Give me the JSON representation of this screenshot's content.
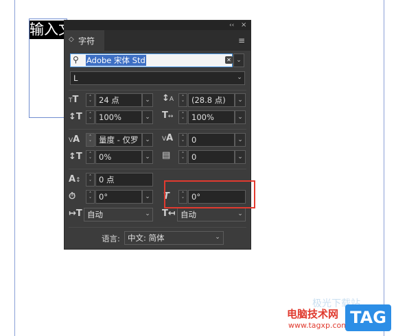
{
  "document": {
    "selected_text": "输入文"
  },
  "panel": {
    "collapse_glyph": "‹‹",
    "close_glyph": "×",
    "tab_label": "字符",
    "tab_arrow": "◇",
    "menu_glyph": "≡",
    "font_family": "Adobe 宋体 Std",
    "font_style": "L",
    "font_size": "24 点",
    "leading": "(28.8 点)",
    "vertical_scale": "100%",
    "horizontal_scale": "100%",
    "kerning": "量度 - 仅罗",
    "tracking": "0",
    "tsume": "0%",
    "grid_indent": "0",
    "baseline_shift": "0 点",
    "rotation": "0°",
    "skew": "0°",
    "aki_left": "自动",
    "aki_right": "自动",
    "language_label": "语言:",
    "language_value": "中文: 简体"
  },
  "watermark": {
    "site_name": "电脑技术网",
    "url": "www.tagxp.com",
    "badge": "TAG",
    "faint": "极光下载站"
  },
  "colors": {
    "panel_bg": "#3c3c3c",
    "highlight": "#e33a2f",
    "accent": "#3d6fc4"
  }
}
